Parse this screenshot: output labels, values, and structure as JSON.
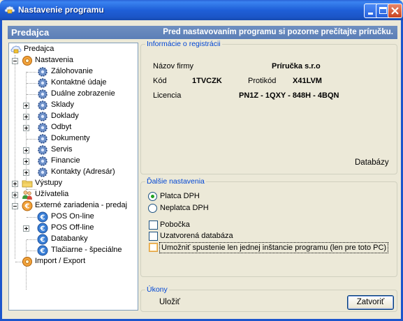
{
  "window": {
    "title": "Nastavenie programu"
  },
  "header": {
    "section": "Predajca",
    "notice": "Pred nastavovaním programu si pozorne prečítajte príručku."
  },
  "tree": {
    "root": "Predajca",
    "nastavenia": "Nastavenia",
    "zalohovanie": "Zálohovanie",
    "kontaktne": "Kontaktné údaje",
    "dualne": "Duálne zobrazenie",
    "sklady": "Sklady",
    "doklady": "Doklady",
    "odbyt": "Odbyt",
    "dokumenty": "Dokumenty",
    "servis": "Servis",
    "financie": "Financie",
    "kontakty": "Kontakty (Adresár)",
    "vystupy": "Výstupy",
    "uzivatelia": "Užívatelia",
    "externe": "Externé zariadenia - predaj",
    "pos_online": "POS On-line",
    "pos_offline": "POS Off-line",
    "databanky": "Databanky",
    "tlaciarne": "Tlačiarne - špeciálne",
    "import_export": "Import / Export"
  },
  "registration": {
    "legend": "Informácie o registrácii",
    "firm_label": "Názov firmy",
    "firm_value": "Príručka s.r.o",
    "code_label": "Kód",
    "code_value": "1TVCZK",
    "protokod_label": "Protikód",
    "protokod_value": "X41LVM",
    "license_label": "Licencia",
    "license_value": "PN1Z - 1QXY - 848H - 4BQN",
    "databases_link": "Databázy"
  },
  "other": {
    "legend": "Ďalšie nastavenia",
    "radio_vat_payer": "Platca DPH",
    "radio_non_payer": "Neplatca DPH",
    "check_branch": "Pobočka",
    "check_closed_db": "Uzatvorená databáza",
    "check_single_instance": "Umožniť spustenie len jednej inštancie programu (len pre toto PC)"
  },
  "actions": {
    "legend": "Úkony",
    "save": "Uložiť",
    "close": "Zatvoriť"
  }
}
